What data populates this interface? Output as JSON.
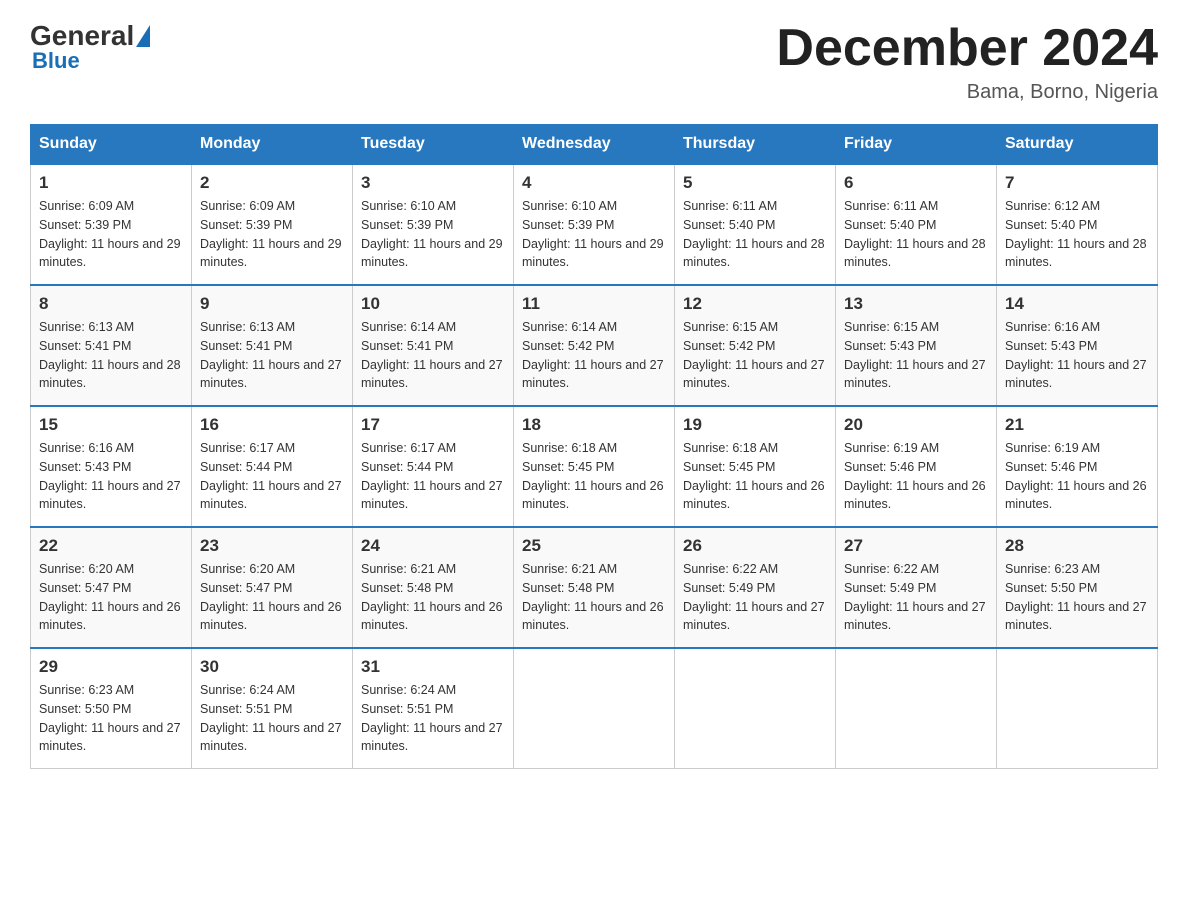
{
  "header": {
    "logo_general": "General",
    "logo_blue": "Blue",
    "month_title": "December 2024",
    "location": "Bama, Borno, Nigeria"
  },
  "weekdays": [
    "Sunday",
    "Monday",
    "Tuesday",
    "Wednesday",
    "Thursday",
    "Friday",
    "Saturday"
  ],
  "weeks": [
    [
      {
        "day": "1",
        "sunrise": "6:09 AM",
        "sunset": "5:39 PM",
        "daylight": "11 hours and 29 minutes."
      },
      {
        "day": "2",
        "sunrise": "6:09 AM",
        "sunset": "5:39 PM",
        "daylight": "11 hours and 29 minutes."
      },
      {
        "day": "3",
        "sunrise": "6:10 AM",
        "sunset": "5:39 PM",
        "daylight": "11 hours and 29 minutes."
      },
      {
        "day": "4",
        "sunrise": "6:10 AM",
        "sunset": "5:39 PM",
        "daylight": "11 hours and 29 minutes."
      },
      {
        "day": "5",
        "sunrise": "6:11 AM",
        "sunset": "5:40 PM",
        "daylight": "11 hours and 28 minutes."
      },
      {
        "day": "6",
        "sunrise": "6:11 AM",
        "sunset": "5:40 PM",
        "daylight": "11 hours and 28 minutes."
      },
      {
        "day": "7",
        "sunrise": "6:12 AM",
        "sunset": "5:40 PM",
        "daylight": "11 hours and 28 minutes."
      }
    ],
    [
      {
        "day": "8",
        "sunrise": "6:13 AM",
        "sunset": "5:41 PM",
        "daylight": "11 hours and 28 minutes."
      },
      {
        "day": "9",
        "sunrise": "6:13 AM",
        "sunset": "5:41 PM",
        "daylight": "11 hours and 27 minutes."
      },
      {
        "day": "10",
        "sunrise": "6:14 AM",
        "sunset": "5:41 PM",
        "daylight": "11 hours and 27 minutes."
      },
      {
        "day": "11",
        "sunrise": "6:14 AM",
        "sunset": "5:42 PM",
        "daylight": "11 hours and 27 minutes."
      },
      {
        "day": "12",
        "sunrise": "6:15 AM",
        "sunset": "5:42 PM",
        "daylight": "11 hours and 27 minutes."
      },
      {
        "day": "13",
        "sunrise": "6:15 AM",
        "sunset": "5:43 PM",
        "daylight": "11 hours and 27 minutes."
      },
      {
        "day": "14",
        "sunrise": "6:16 AM",
        "sunset": "5:43 PM",
        "daylight": "11 hours and 27 minutes."
      }
    ],
    [
      {
        "day": "15",
        "sunrise": "6:16 AM",
        "sunset": "5:43 PM",
        "daylight": "11 hours and 27 minutes."
      },
      {
        "day": "16",
        "sunrise": "6:17 AM",
        "sunset": "5:44 PM",
        "daylight": "11 hours and 27 minutes."
      },
      {
        "day": "17",
        "sunrise": "6:17 AM",
        "sunset": "5:44 PM",
        "daylight": "11 hours and 27 minutes."
      },
      {
        "day": "18",
        "sunrise": "6:18 AM",
        "sunset": "5:45 PM",
        "daylight": "11 hours and 26 minutes."
      },
      {
        "day": "19",
        "sunrise": "6:18 AM",
        "sunset": "5:45 PM",
        "daylight": "11 hours and 26 minutes."
      },
      {
        "day": "20",
        "sunrise": "6:19 AM",
        "sunset": "5:46 PM",
        "daylight": "11 hours and 26 minutes."
      },
      {
        "day": "21",
        "sunrise": "6:19 AM",
        "sunset": "5:46 PM",
        "daylight": "11 hours and 26 minutes."
      }
    ],
    [
      {
        "day": "22",
        "sunrise": "6:20 AM",
        "sunset": "5:47 PM",
        "daylight": "11 hours and 26 minutes."
      },
      {
        "day": "23",
        "sunrise": "6:20 AM",
        "sunset": "5:47 PM",
        "daylight": "11 hours and 26 minutes."
      },
      {
        "day": "24",
        "sunrise": "6:21 AM",
        "sunset": "5:48 PM",
        "daylight": "11 hours and 26 minutes."
      },
      {
        "day": "25",
        "sunrise": "6:21 AM",
        "sunset": "5:48 PM",
        "daylight": "11 hours and 26 minutes."
      },
      {
        "day": "26",
        "sunrise": "6:22 AM",
        "sunset": "5:49 PM",
        "daylight": "11 hours and 27 minutes."
      },
      {
        "day": "27",
        "sunrise": "6:22 AM",
        "sunset": "5:49 PM",
        "daylight": "11 hours and 27 minutes."
      },
      {
        "day": "28",
        "sunrise": "6:23 AM",
        "sunset": "5:50 PM",
        "daylight": "11 hours and 27 minutes."
      }
    ],
    [
      {
        "day": "29",
        "sunrise": "6:23 AM",
        "sunset": "5:50 PM",
        "daylight": "11 hours and 27 minutes."
      },
      {
        "day": "30",
        "sunrise": "6:24 AM",
        "sunset": "5:51 PM",
        "daylight": "11 hours and 27 minutes."
      },
      {
        "day": "31",
        "sunrise": "6:24 AM",
        "sunset": "5:51 PM",
        "daylight": "11 hours and 27 minutes."
      },
      null,
      null,
      null,
      null
    ]
  ]
}
